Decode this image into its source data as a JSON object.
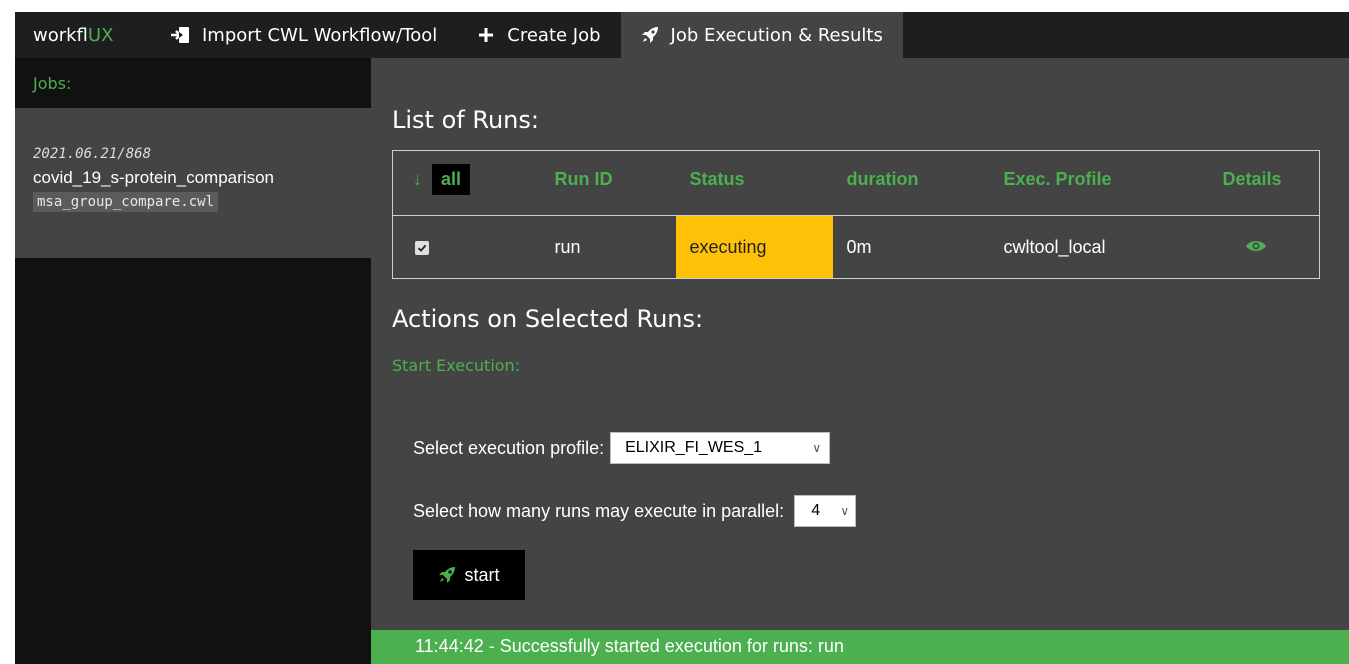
{
  "app": {
    "brand_prefix": "workfl",
    "brand_suffix": "UX",
    "accent_color": "#4caf50",
    "highlight_color": "#ffc107"
  },
  "nav": {
    "items": [
      {
        "label": "Import CWL Workflow/Tool",
        "icon": "import-icon"
      },
      {
        "label": "Create Job",
        "icon": "plus-icon"
      },
      {
        "label": "Job Execution & Results",
        "icon": "rocket-icon",
        "active": true
      }
    ]
  },
  "sidebar": {
    "title": "Jobs:",
    "job": {
      "date": "2021.06.21/868",
      "name": "covid_19_s-protein_comparison",
      "file": "msa_group_compare.cwl"
    }
  },
  "runs": {
    "title": "List of Runs:",
    "all_label": "all",
    "headers": {
      "run_id": "Run ID",
      "status": "Status",
      "duration": "duration",
      "exec_profile": "Exec. Profile",
      "details": "Details"
    },
    "rows": [
      {
        "checked": true,
        "run_id": "run",
        "status": "executing",
        "duration": "0m",
        "exec_profile": "cwltool_local",
        "details_icon": "eye-icon"
      }
    ]
  },
  "actions": {
    "title": "Actions on Selected Runs:",
    "start_execution_label": "Start Execution:",
    "profile_label": "Select execution profile:",
    "profile_value": "ELIXIR_FI_WES_1",
    "parallel_label": "Select how many runs may execute in parallel:",
    "parallel_value": "4",
    "start_label": "start"
  },
  "status_message": "11:44:42 - Successfully started execution for runs: run"
}
